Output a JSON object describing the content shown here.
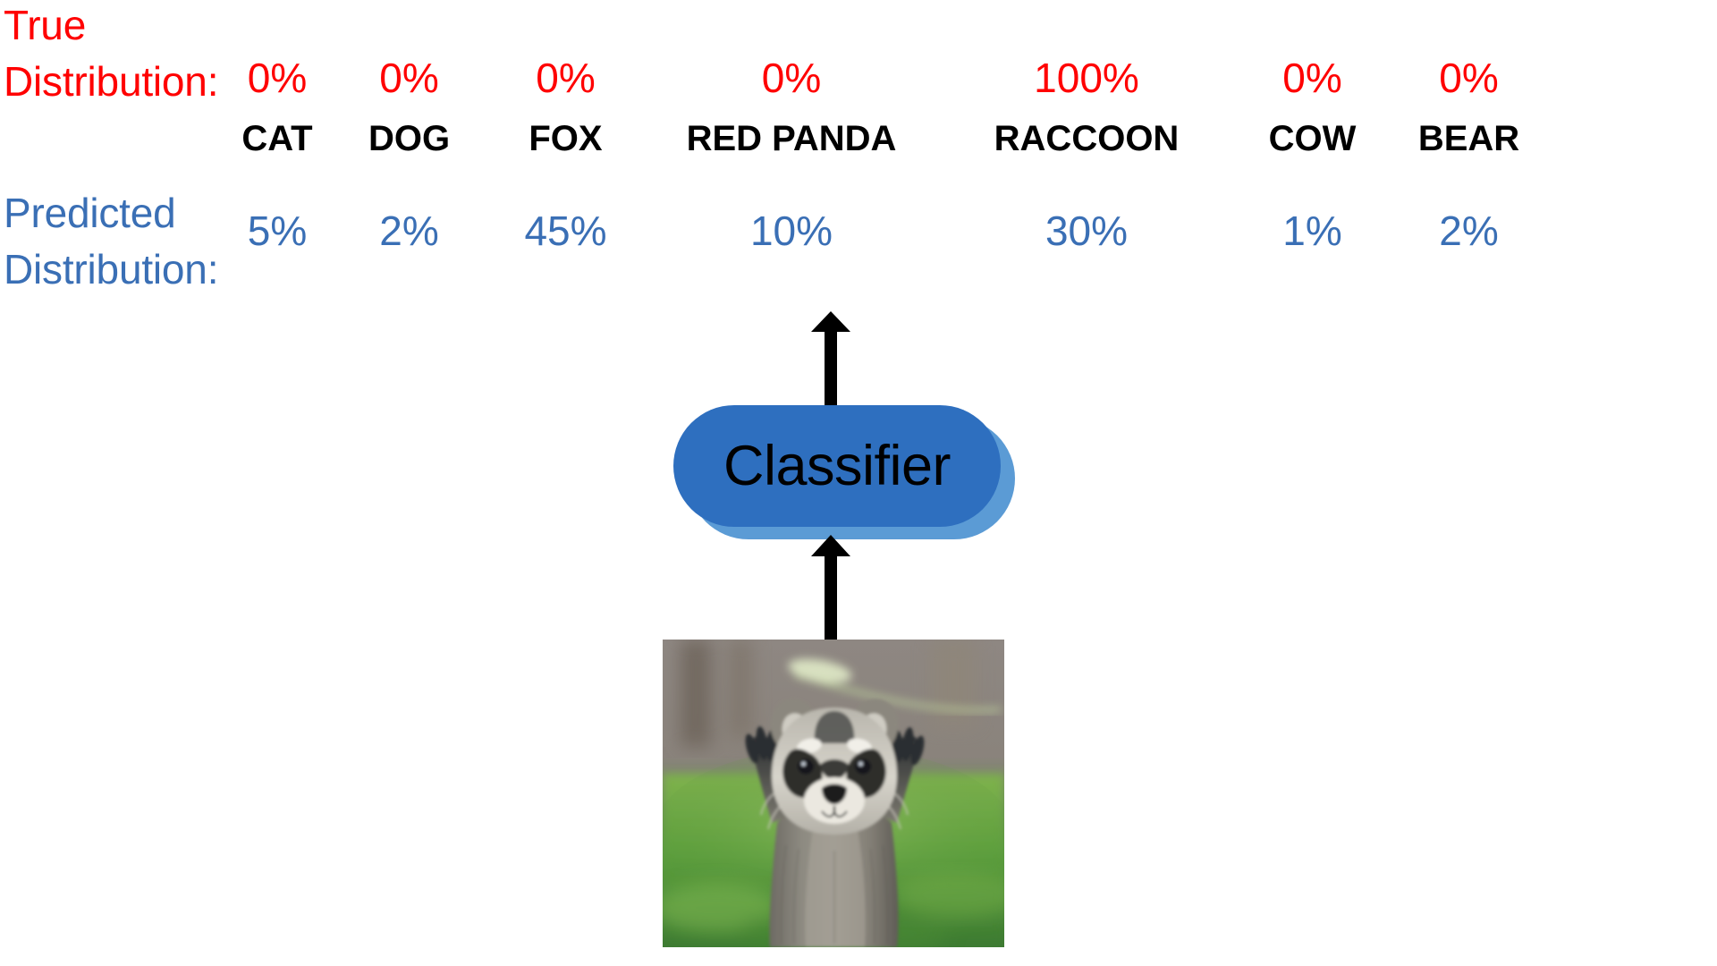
{
  "figure": {
    "true_row_label": [
      "True",
      "Distribution:"
    ],
    "predicted_row_label": [
      "Predicted",
      "Distribution:"
    ],
    "classifier_label": "Classifier",
    "colors": {
      "true_color": "#FF0000",
      "predicted_color": "#3A6FB5",
      "class_label_color": "#000000",
      "classifier_fill": "#2E6FBF",
      "classifier_shadow": "#5B9BD5",
      "arrow_color": "#000000",
      "background": "#FFFFFF"
    },
    "arrows": [
      {
        "name": "classifier-to-output-arrow",
        "direction": "up"
      },
      {
        "name": "input-to-classifier-arrow",
        "direction": "up"
      }
    ],
    "input_image": {
      "name": "raccoon-photo",
      "subject": "raccoon",
      "description": "Photo of a raccoon standing with both front paws raised, green grass background"
    }
  },
  "chart_data": {
    "type": "table",
    "title": "Classifier true vs predicted distribution",
    "categories": [
      "CAT",
      "DOG",
      "FOX",
      "RED PANDA",
      "RACCOON",
      "COW",
      "BEAR"
    ],
    "series": [
      {
        "name": "True Distribution:",
        "color": "#FF0000",
        "values": [
          0,
          0,
          0,
          0,
          100,
          0,
          0
        ],
        "labels": [
          "0%",
          "0%",
          "0%",
          "0%",
          "100%",
          "0%",
          "0%"
        ]
      },
      {
        "name": "Predicted Distribution:",
        "color": "#3A6FB5",
        "values": [
          5,
          2,
          45,
          10,
          30,
          1,
          2
        ],
        "labels": [
          "5%",
          "2%",
          "45%",
          "10%",
          "30%",
          "1%",
          "2%"
        ]
      }
    ],
    "units": "percent",
    "xlabel": "",
    "ylabel": "",
    "grid": false,
    "legend": "none"
  }
}
